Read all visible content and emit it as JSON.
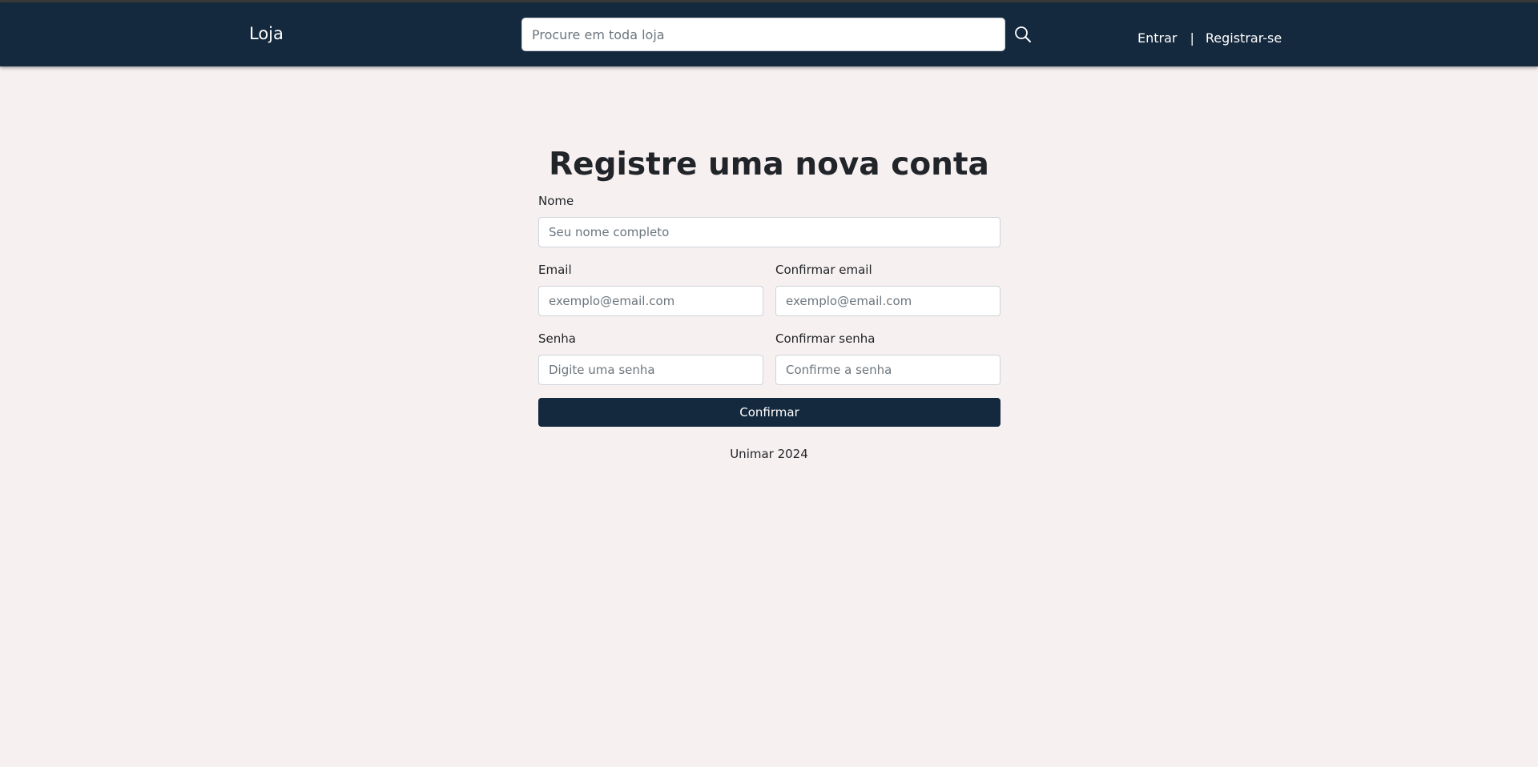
{
  "header": {
    "brand": "Loja",
    "search": {
      "placeholder": "Procure em toda loja",
      "value": "",
      "icon": "search-icon"
    },
    "links": {
      "login": "Entrar",
      "separator": "|",
      "register": "Registrar-se"
    }
  },
  "main": {
    "title": "Registre uma nova conta",
    "form": {
      "name": {
        "label": "Nome",
        "placeholder": "Seu nome completo"
      },
      "email": {
        "label": "Email",
        "placeholder": "exemplo@email.com"
      },
      "confirm_email": {
        "label": "Confirmar email",
        "placeholder": "exemplo@email.com"
      },
      "password": {
        "label": "Senha",
        "placeholder": "Digite uma senha"
      },
      "confirm_password": {
        "label": "Confirmar senha",
        "placeholder": "Confirme a senha"
      },
      "submit_label": "Confirmar"
    }
  },
  "footer": {
    "text": "Unimar 2024"
  },
  "colors": {
    "navbar": "#14283e",
    "page_background": "#f7f0f0",
    "primary_button": "#14283e"
  }
}
